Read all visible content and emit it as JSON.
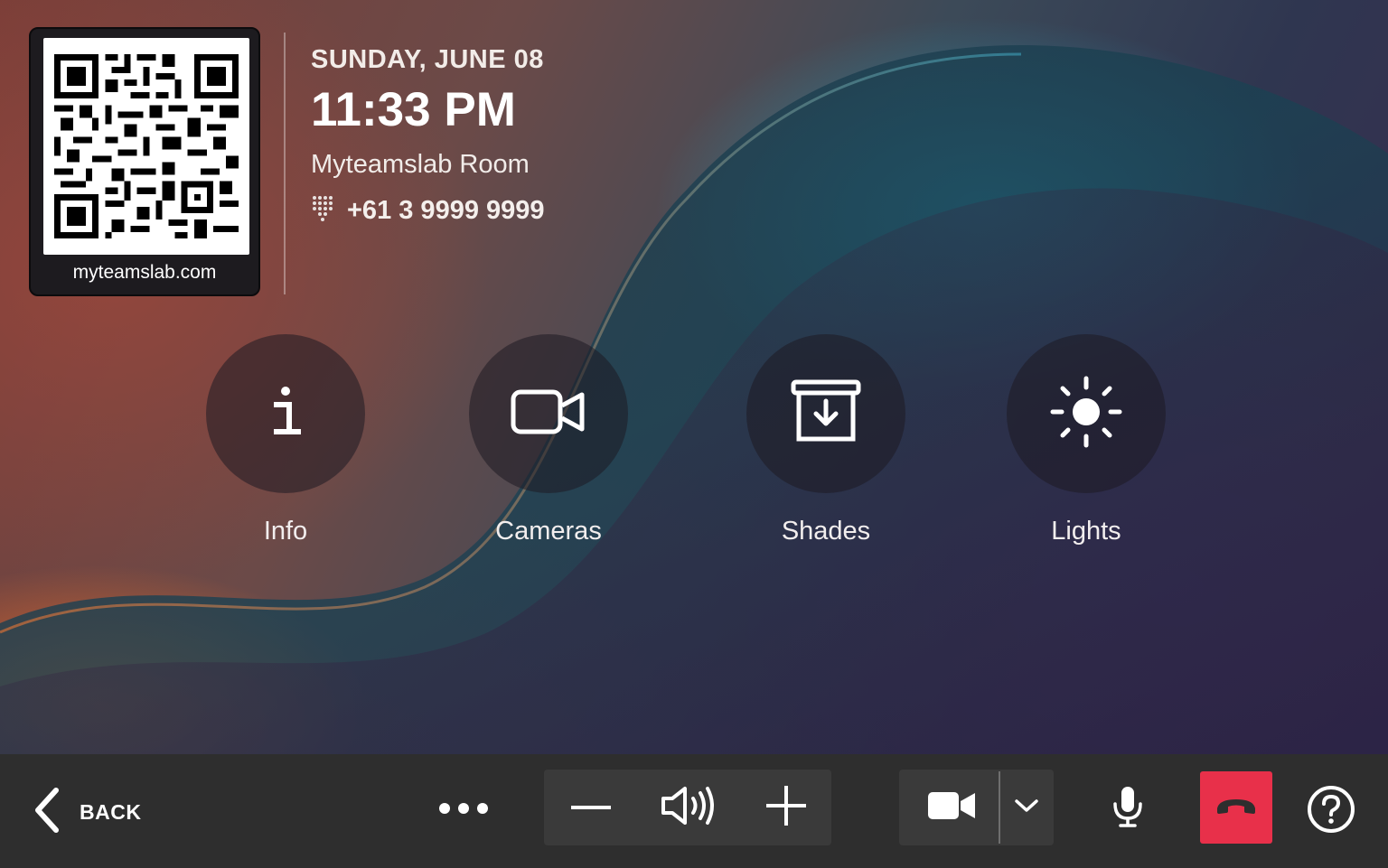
{
  "header": {
    "qr_caption": "myteamslab.com",
    "date": "SUNDAY, JUNE 08",
    "time": "11:33 PM",
    "room_name": "Myteamslab Room",
    "phone": "+61 3 9999 9999"
  },
  "tiles": [
    {
      "label": "Info",
      "icon": "info-icon"
    },
    {
      "label": "Cameras",
      "icon": "video-camera-icon"
    },
    {
      "label": "Shades",
      "icon": "shades-icon"
    },
    {
      "label": "Lights",
      "icon": "sun-icon"
    }
  ],
  "bottom_bar": {
    "back_label": "BACK",
    "hangup_color": "#e8304a",
    "icons": [
      "chevron-left-icon",
      "more-icon",
      "minus-icon",
      "speaker-icon",
      "plus-icon",
      "camera-icon",
      "chevron-down-icon",
      "microphone-icon",
      "hang-up-icon",
      "help-icon"
    ]
  }
}
